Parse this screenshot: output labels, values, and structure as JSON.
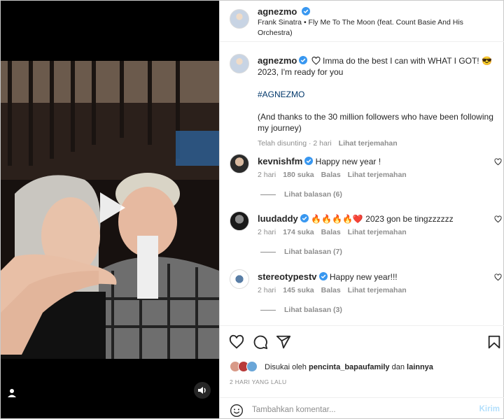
{
  "post": {
    "username": "agnezmo",
    "song": "Frank Sinatra • Fly Me To The Moon (feat. Count Basie And His Orchestra)"
  },
  "caption": {
    "username": "agnezmo",
    "line1": " Imma do the best I can with WHAT I GOT! 😎 2023, I'm ready for you",
    "hashtag": "#AGNEZMO",
    "line2": "(And thanks to the 30 million followers who have been following my journey)",
    "edited": "Telah disunting · 2 hari",
    "translate": "Lihat terjemahan"
  },
  "comments": [
    {
      "username": "kevnishfm",
      "text": "Happy new year !",
      "time": "2 hari",
      "likes": "180 suka",
      "reply": "Balas",
      "translate": "Lihat terjemahan",
      "replies": "Lihat balasan (6)"
    },
    {
      "username": "luudaddy",
      "text": "🔥🔥🔥🔥❤️ 2023 gon be tingzzzzzz",
      "time": "2 hari",
      "likes": "174 suka",
      "reply": "Balas",
      "translate": "Lihat terjemahan",
      "replies": "Lihat balasan (7)"
    },
    {
      "username": "stereotypestv",
      "text": "Happy new year!!!",
      "time": "2 hari",
      "likes": "145 suka",
      "reply": "Balas",
      "translate": "Lihat terjemahan",
      "replies": "Lihat balasan (3)"
    }
  ],
  "likes": {
    "prefix": "Disukai oleh ",
    "user": "pencinta_bapaufamily",
    "middle": " dan ",
    "others": "lainnya"
  },
  "timeago": "2 HARI YANG LALU",
  "comment_box": {
    "placeholder": "Tambahkan komentar...",
    "post_label": "Kirim"
  },
  "icons": {
    "verified": "verified-badge-icon",
    "heart": "heart-icon",
    "comment": "comment-icon",
    "share": "send-icon",
    "save": "bookmark-icon",
    "emoji": "emoji-icon",
    "play": "play-icon",
    "mute": "speaker-icon",
    "tag": "user-tag-icon"
  },
  "colors": {
    "verified": "#3897f0",
    "link": "#00376b",
    "muted": "#8e8e8e",
    "post_disabled": "#b2dffc"
  }
}
